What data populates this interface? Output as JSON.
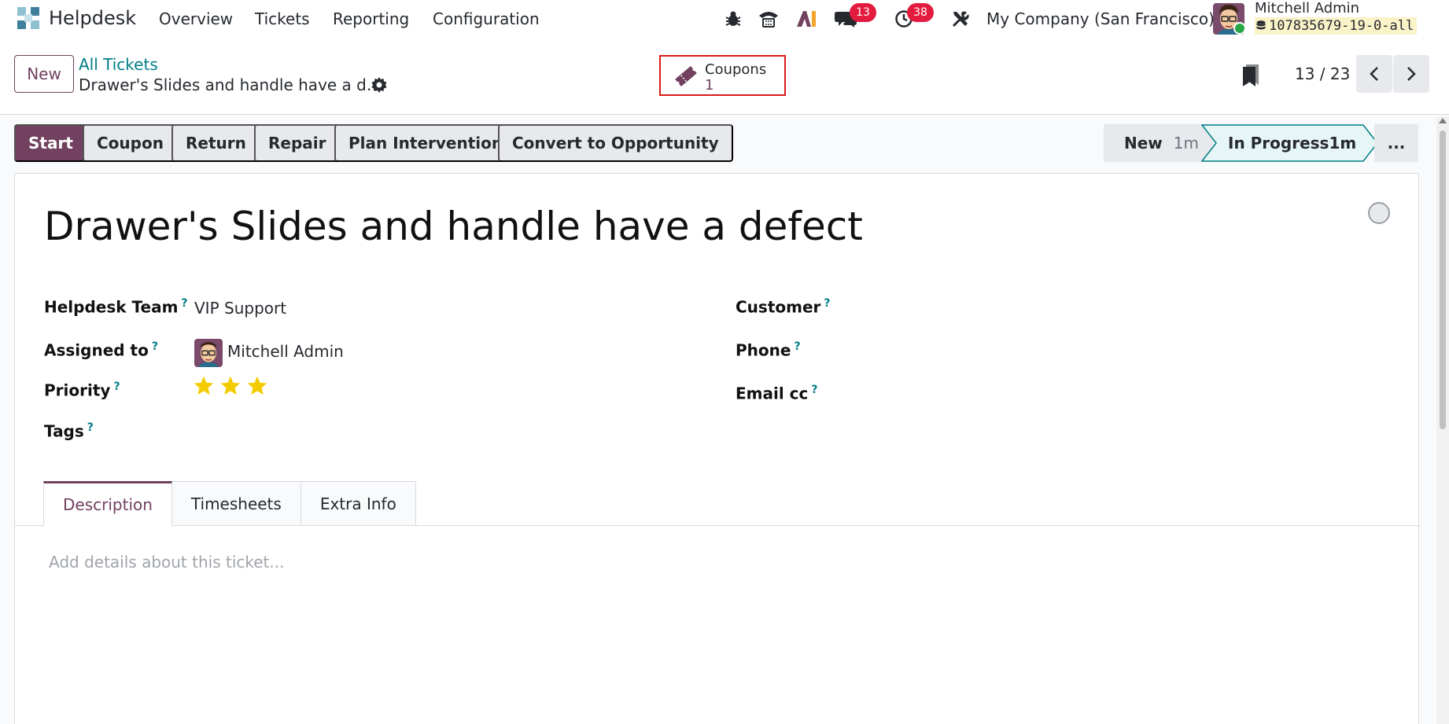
{
  "nav": {
    "app_name": "Helpdesk",
    "menu": [
      "Overview",
      "Tickets",
      "Reporting",
      "Configuration"
    ],
    "messages_badge": "13",
    "activities_badge": "38",
    "company": "My Company (San Francisco)",
    "user_name": "Mitchell Admin",
    "database": "107835679-19-0-all"
  },
  "control": {
    "new_label": "New",
    "breadcrumb": "All Tickets",
    "record_title": "Drawer's Slides and handle have a d…",
    "smart_button": {
      "label": "Coupons",
      "count": "1"
    },
    "pager": "13 / 23"
  },
  "actions": [
    "Start",
    "Coupon",
    "Return",
    "Repair",
    "Plan Intervention",
    "Convert to Opportunity"
  ],
  "stages": {
    "new": {
      "label": "New",
      "duration": "1m"
    },
    "in_progress": {
      "label": "In Progress",
      "duration": "1m"
    },
    "more": "..."
  },
  "ticket": {
    "title": "Drawer's Slides and handle have a defect",
    "fields": {
      "team_label": "Helpdesk Team",
      "team_value": "VIP Support",
      "assigned_label": "Assigned to",
      "assigned_value": "Mitchell Admin",
      "priority_label": "Priority",
      "priority_stars": 3,
      "tags_label": "Tags",
      "customer_label": "Customer",
      "phone_label": "Phone",
      "email_cc_label": "Email cc",
      "help_mark": "?"
    },
    "tabs": [
      "Description",
      "Timesheets",
      "Extra Info"
    ],
    "description_placeholder": "Add details about this ticket..."
  },
  "colors": {
    "brand": "#71415f",
    "link": "#017e84",
    "badge": "#e31b3e",
    "stage_active": "#e6f6f7",
    "star": "#f3cc00"
  },
  "icons": [
    "helpdesk-logo-icon",
    "bug-icon",
    "phone-icon",
    "ai-icon",
    "chat-icon",
    "clock-icon",
    "tools-icon",
    "database-icon",
    "gear-icon",
    "coupon-icon",
    "bookmark-icon",
    "chevron-left-icon",
    "chevron-right-icon",
    "star-icon"
  ]
}
